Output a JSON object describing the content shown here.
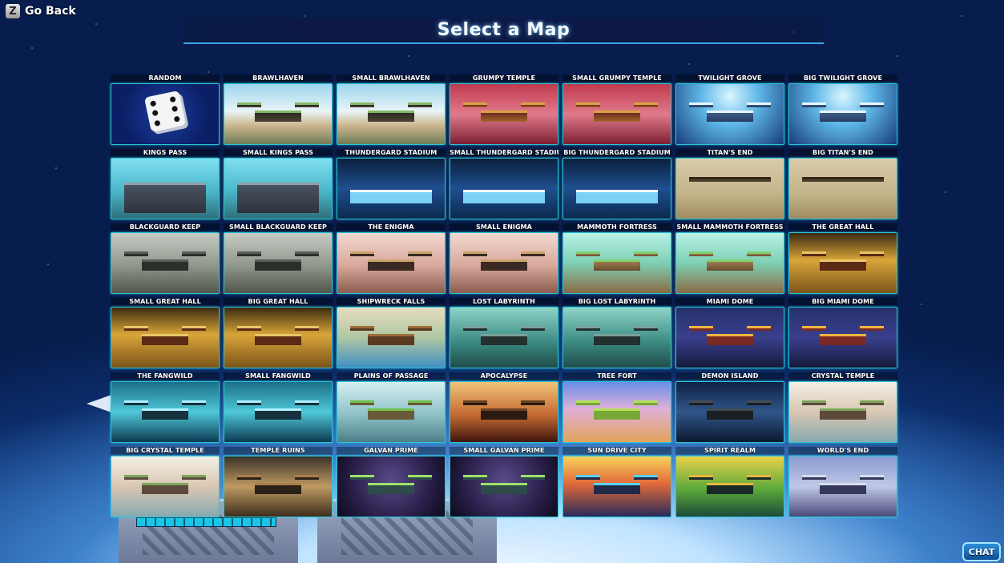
{
  "header": {
    "back_key": "Z",
    "back_label": "Go Back",
    "title": "Select a Map"
  },
  "maps": [
    {
      "label": "RANDOM",
      "theme": "random",
      "icon": "dice-icon"
    },
    {
      "label": "BRAWLHAVEN",
      "theme": "brawlhaven"
    },
    {
      "label": "SMALL BRAWLHAVEN",
      "theme": "brawlhaven"
    },
    {
      "label": "GRUMPY TEMPLE",
      "theme": "grumpy"
    },
    {
      "label": "SMALL GRUMPY TEMPLE",
      "theme": "grumpy"
    },
    {
      "label": "TWILIGHT GROVE",
      "theme": "twilight"
    },
    {
      "label": "BIG TWILIGHT GROVE",
      "theme": "twilight"
    },
    {
      "label": "KINGS PASS",
      "theme": "kings"
    },
    {
      "label": "SMALL KINGS PASS",
      "theme": "kings"
    },
    {
      "label": "THUNDERGARD STADIUM",
      "theme": "thunder"
    },
    {
      "label": "SMALL THUNDERGARD STADIU",
      "theme": "thunder"
    },
    {
      "label": "BIG THUNDERGARD STADIUM",
      "theme": "thunder"
    },
    {
      "label": "TITAN'S END",
      "theme": "titan"
    },
    {
      "label": "BIG TITAN'S END",
      "theme": "titan"
    },
    {
      "label": "BLACKGUARD KEEP",
      "theme": "blackguard"
    },
    {
      "label": "SMALL BLACKGUARD KEEP",
      "theme": "blackguard"
    },
    {
      "label": "THE ENIGMA",
      "theme": "enigma"
    },
    {
      "label": "SMALL ENIGMA",
      "theme": "enigma"
    },
    {
      "label": "MAMMOTH FORTRESS",
      "theme": "mammoth"
    },
    {
      "label": "SMALL MAMMOTH FORTRESS",
      "theme": "mammoth"
    },
    {
      "label": "THE GREAT HALL",
      "theme": "hall"
    },
    {
      "label": "SMALL GREAT HALL",
      "theme": "hall"
    },
    {
      "label": "BIG GREAT HALL",
      "theme": "hall"
    },
    {
      "label": "SHIPWRECK FALLS",
      "theme": "shipwreck"
    },
    {
      "label": "LOST LABYRINTH",
      "theme": "labyrinth"
    },
    {
      "label": "BIG LOST LABYRINTH",
      "theme": "labyrinth"
    },
    {
      "label": "MIAMI DOME",
      "theme": "miami"
    },
    {
      "label": "BIG MIAMI DOME",
      "theme": "miami"
    },
    {
      "label": "THE FANGWILD",
      "theme": "fangwild"
    },
    {
      "label": "SMALL FANGWILD",
      "theme": "fangwild"
    },
    {
      "label": "PLAINS OF PASSAGE",
      "theme": "plains"
    },
    {
      "label": "APOCALYPSE",
      "theme": "apoc"
    },
    {
      "label": "TREE FORT",
      "theme": "treefort"
    },
    {
      "label": "DEMON ISLAND",
      "theme": "demon"
    },
    {
      "label": "CRYSTAL TEMPLE",
      "theme": "crystal"
    },
    {
      "label": "BIG CRYSTAL TEMPLE",
      "theme": "crystal"
    },
    {
      "label": "TEMPLE RUINS",
      "theme": "ruins"
    },
    {
      "label": "GALVAN PRIME",
      "theme": "galvan"
    },
    {
      "label": "SMALL GALVAN PRIME",
      "theme": "galvan"
    },
    {
      "label": "SUN DRIVE CITY",
      "theme": "sundrive"
    },
    {
      "label": "SPIRIT REALM",
      "theme": "spirit"
    },
    {
      "label": "WORLD'S END",
      "theme": "worldsend"
    }
  ],
  "footer": {
    "chat_label": "CHAT"
  },
  "colors": {
    "tile_border": "#27c7d8",
    "title_glow": "#6fc2ff"
  }
}
